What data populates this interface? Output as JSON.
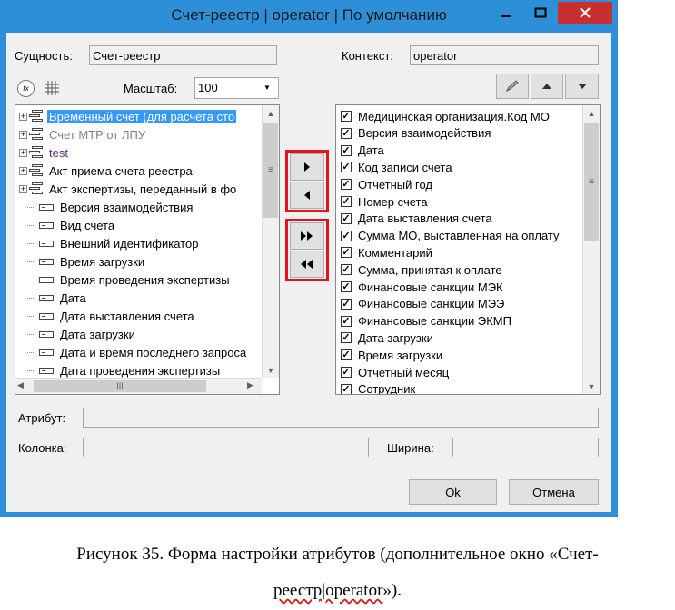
{
  "window": {
    "title": "Счет-реестр | operator | По умолчанию"
  },
  "left": {
    "entity_label": "Сущность:",
    "entity_value": "Счет-реестр",
    "scale_label": "Масштаб:",
    "scale_value": "100",
    "tree_items": [
      {
        "label": "Временный счет (для расчета сто",
        "kind": "entity",
        "style": "sel"
      },
      {
        "label": "Счет МТР от ЛПУ",
        "kind": "entity",
        "style": "grey"
      },
      {
        "label": "test",
        "kind": "entity",
        "style": "purple"
      },
      {
        "label": "Акт приема счета реестра",
        "kind": "entity",
        "style": ""
      },
      {
        "label": "Акт экспертизы, переданный в фо",
        "kind": "entity",
        "style": ""
      },
      {
        "label": "Версия взаимодействия",
        "kind": "attr",
        "style": ""
      },
      {
        "label": "Вид счета",
        "kind": "attr",
        "style": ""
      },
      {
        "label": "Внешний идентификатор",
        "kind": "attr",
        "style": ""
      },
      {
        "label": "Время загрузки",
        "kind": "attr",
        "style": ""
      },
      {
        "label": "Время проведения экспертизы",
        "kind": "attr",
        "style": ""
      },
      {
        "label": "Дата",
        "kind": "attr",
        "style": ""
      },
      {
        "label": "Дата выставления счета",
        "kind": "attr",
        "style": ""
      },
      {
        "label": "Дата загрузки",
        "kind": "attr",
        "style": ""
      },
      {
        "label": "Дата и время последнего запроса",
        "kind": "attr",
        "style": ""
      },
      {
        "label": "Дата проведения экспертизы",
        "kind": "attr",
        "style": ""
      }
    ]
  },
  "right": {
    "context_label": "Контекст:",
    "context_value": "operator",
    "items": [
      {
        "label": "Медицинская организация.Код МО",
        "checked": true
      },
      {
        "label": "Версия взаимодействия",
        "checked": true
      },
      {
        "label": "Дата",
        "checked": true
      },
      {
        "label": "Код записи счета",
        "checked": true
      },
      {
        "label": "Отчетный год",
        "checked": true
      },
      {
        "label": "Номер счета",
        "checked": true
      },
      {
        "label": "Дата выставления счета",
        "checked": true
      },
      {
        "label": "Сумма МО, выставленная на оплату",
        "checked": true
      },
      {
        "label": "Комментарий",
        "checked": true
      },
      {
        "label": "Сумма, принятая к оплате",
        "checked": true
      },
      {
        "label": "Финансовые санкции МЭК",
        "checked": true
      },
      {
        "label": "Финансовые санкции МЭЭ",
        "checked": true
      },
      {
        "label": "Финансовые санкции ЭКМП",
        "checked": true
      },
      {
        "label": "Дата загрузки",
        "checked": true
      },
      {
        "label": "Время загрузки",
        "checked": true
      },
      {
        "label": "Отчетный месяц",
        "checked": true
      },
      {
        "label": "Сотрудник",
        "checked": true
      }
    ]
  },
  "bottom": {
    "attribute_label": "Атрибут:",
    "attribute_value": "",
    "column_label": "Колонка:",
    "column_value": "",
    "width_label": "Ширина:",
    "width_value": "",
    "ok_label": "Ok",
    "cancel_label": "Отмена"
  },
  "caption": {
    "line1": "Рисунок 35. Форма настройки атрибутов (дополнительное окно «Счет-",
    "line2_a": "реестр|operator",
    "line2_b": "»)."
  },
  "icons": {
    "filter": "fx-filter-icon",
    "grid": "grid-icon",
    "edit": "pencil-icon"
  },
  "colors": {
    "titlebar": "#2c8fd8",
    "close": "#c7302f",
    "selection": "#3399ff",
    "highlight_frame": "#e3121d"
  }
}
